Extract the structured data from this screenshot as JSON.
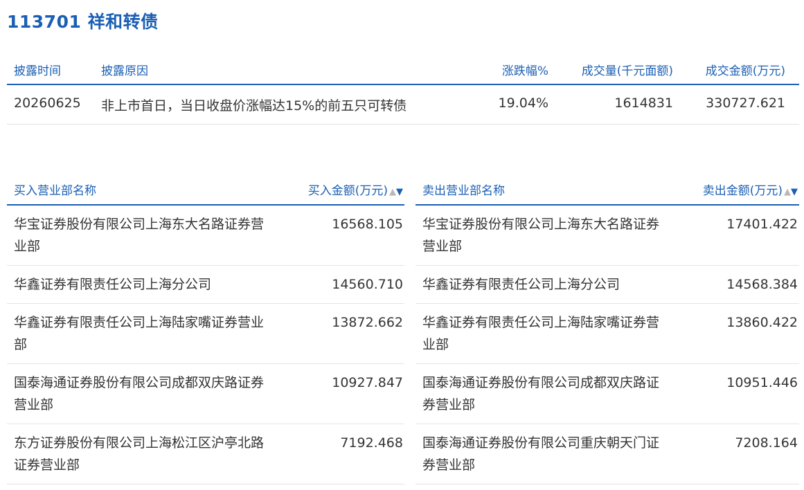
{
  "page": {
    "title": "113701 祥和转债"
  },
  "colors": {
    "accent": "#1a5fb4",
    "text": "#333333",
    "divider": "#e4e4e4",
    "sort_inactive": "#b8b8b8"
  },
  "disclosure": {
    "headers": {
      "date": "披露时间",
      "reason": "披露原因",
      "change_pct": "涨跌幅%",
      "volume": "成交量(千元面额)",
      "amount": "成交金额(万元)"
    },
    "rows": [
      {
        "date": "20260625",
        "reason": "非上市首日，当日收盘价涨幅达15%的前五只可转债",
        "change_pct": "19.04%",
        "volume": "1614831",
        "amount": "330727.621"
      }
    ]
  },
  "buy": {
    "header_name": "买入营业部名称",
    "header_amount": "买入金额(万元)",
    "sort_up_icon": "▲",
    "sort_down_icon": "▼",
    "rows": [
      {
        "name": "华宝证券股份有限公司上海东大名路证券营业部",
        "amount": "16568.105"
      },
      {
        "name": "华鑫证券有限责任公司上海分公司",
        "amount": "14560.710"
      },
      {
        "name": "华鑫证券有限责任公司上海陆家嘴证券营业部",
        "amount": "13872.662"
      },
      {
        "name": "国泰海通证券股份有限公司成都双庆路证券营业部",
        "amount": "10927.847"
      },
      {
        "name": "东方证券股份有限公司上海松江区沪亭北路证券营业部",
        "amount": "7192.468"
      }
    ]
  },
  "sell": {
    "header_name": "卖出营业部名称",
    "header_amount": "卖出金额(万元)",
    "sort_up_icon": "▲",
    "sort_down_icon": "▼",
    "rows": [
      {
        "name": "华宝证券股份有限公司上海东大名路证券营业部",
        "amount": "17401.422"
      },
      {
        "name": "华鑫证券有限责任公司上海分公司",
        "amount": "14568.384"
      },
      {
        "name": "华鑫证券有限责任公司上海陆家嘴证券营业部",
        "amount": "13860.422"
      },
      {
        "name": "国泰海通证券股份有限公司成都双庆路证券营业部",
        "amount": "10951.446"
      },
      {
        "name": "国泰海通证券股份有限公司重庆朝天门证券营业部",
        "amount": "7208.164"
      }
    ]
  }
}
